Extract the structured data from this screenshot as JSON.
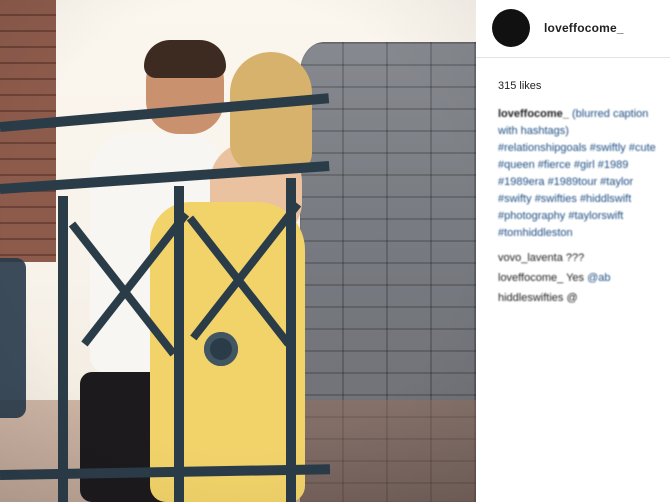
{
  "sidebar": {
    "handle": "loveffocome_",
    "likes": "315 likes",
    "caption": {
      "user": "loveffocome_",
      "text": "(blurred caption with hashtags)"
    },
    "hashtags": [
      "#relationshipgoals",
      "#swiftly",
      "#cute",
      "#queen",
      "#fierce",
      "#girl",
      "#1989",
      "#1989era",
      "#1989tour",
      "#taylor",
      "#swifty",
      "#swifties",
      "#hiddlswift",
      "#photography",
      "#taylorswift",
      "#tomhiddleston"
    ],
    "comments": [
      {
        "user": "vovo_laventa",
        "text": "???"
      },
      {
        "user": "loveffocome_",
        "text": "Yes",
        "tag": "@ab"
      },
      {
        "user": "hiddleswifties",
        "text": "@"
      }
    ]
  },
  "colors": {
    "sidebar_bg": "#ffffff",
    "link_blue": "#1f4e84",
    "rail": "#2b3c49",
    "wall_stone": "#6b6f75"
  }
}
